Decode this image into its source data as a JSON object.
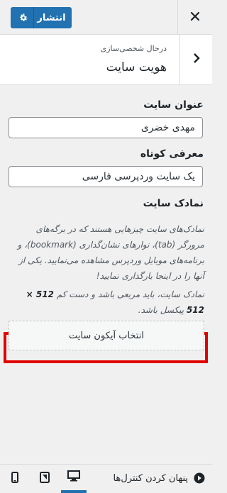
{
  "topbar": {
    "publish_label": "انتشار",
    "accent": "#2271b1"
  },
  "section": {
    "breadcrumb": "درحال شخصی‌سازی",
    "title": "هویت سایت"
  },
  "site_title": {
    "label": "عنوان سایت",
    "value": "مهدی خضری"
  },
  "tagline": {
    "label": "معرفی کوتاه",
    "value": "یک سایت وردپرسی فارسی"
  },
  "site_icon": {
    "label": "نمادک سایت",
    "desc1": "نمادک‌های سایت چیزهایی هستند که در برگه‌های مرورگر (tab)، نوارهای نشان‌گذاری (bookmark)، و برنامه‌های موبایل وردپرس مشاهده می‌نمایید. یکی از آنها را در اینجا بارگذاری نمایید!",
    "desc2_prefix": "نمادک سایت، باید مربعی باشد و دست کم ",
    "desc2_size": "512 × 512",
    "desc2_suffix": " پیکسل باشد.",
    "button_label": "انتخاب آیکون سایت"
  },
  "footer": {
    "hide_controls_label": "پنهان کردن کنترل‌ها"
  },
  "colors": {
    "highlight": "#e00000"
  }
}
